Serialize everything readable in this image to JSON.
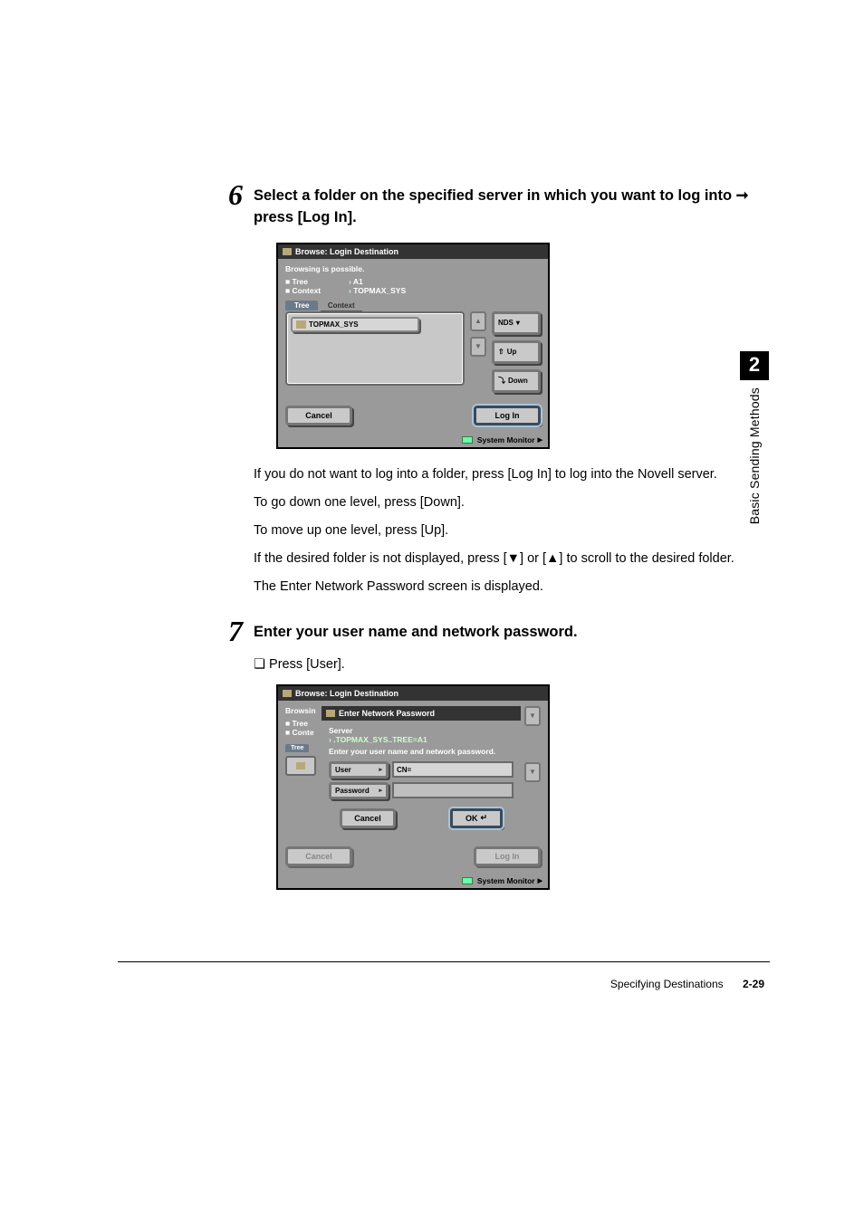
{
  "sideTab": {
    "chapter": "2",
    "label": "Basic Sending Methods"
  },
  "step6": {
    "num": "6",
    "heading": "Select a folder on the specified server in which you want to log into ➞ press [Log In].",
    "para1": "If you do not want to log into a folder, press [Log In] to log into the Novell server.",
    "para2": "To go down one level, press [Down].",
    "para3": "To move up one level, press [Up].",
    "para4": "If the desired folder is not displayed, press [▼] or [▲] to scroll to the desired folder.",
    "para5": "The Enter Network Password screen is displayed."
  },
  "step7": {
    "num": "7",
    "heading": "Enter your user name and network password.",
    "sub": "Press [User]."
  },
  "shot1": {
    "title": "Browse: Login Destination",
    "status": "Browsing is possible.",
    "treeLabel": "■ Tree",
    "contextLabel": "■ Context",
    "treeVal": "A1",
    "contextVal": "TOPMAX_SYS",
    "treeTab": "Tree",
    "contextTab": "Context",
    "item": "TOPMAX_SYS",
    "nds": "NDS",
    "up": "Up",
    "down": "Down",
    "cancel": "Cancel",
    "login": "Log In",
    "sysmon": "System Monitor"
  },
  "shot2": {
    "title": "Browse: Login Destination",
    "leftStatus": "Browsin",
    "leftTree": "■ Tree",
    "leftContext": "■ Conte",
    "leftTab": "Tree",
    "dlgTitle": "Enter Network Password",
    "server": "Server",
    "serverPath": ".TOPMAX_SYS..TREE=A1",
    "prompt": "Enter your user name and network password.",
    "user": "User",
    "cn": "CN=",
    "password": "Password",
    "dlgCancel": "Cancel",
    "ok": "OK",
    "bgCancel": "Cancel",
    "bgLogin": "Log In",
    "sysmon": "System Monitor"
  },
  "footer": {
    "section": "Specifying Destinations",
    "page": "2-29"
  }
}
